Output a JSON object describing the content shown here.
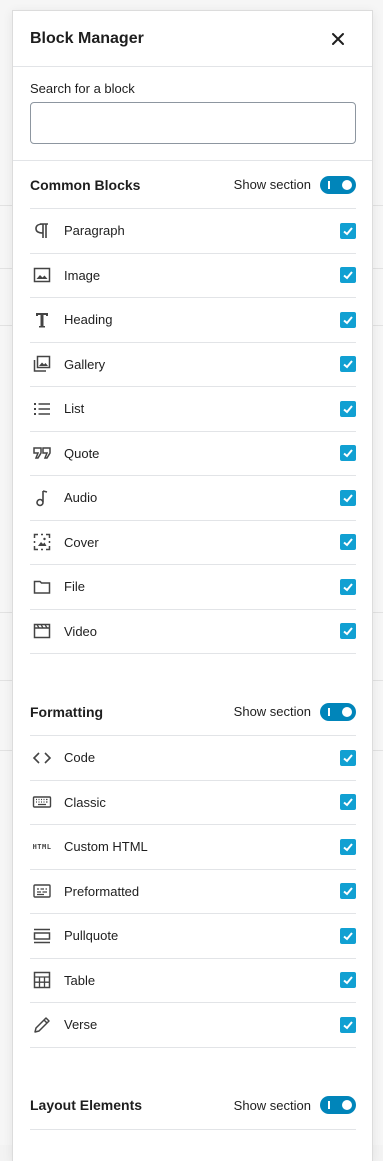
{
  "modal": {
    "title": "Block Manager",
    "close_icon": "close-icon"
  },
  "search": {
    "label": "Search for a block",
    "value": "",
    "placeholder": ""
  },
  "sections": [
    {
      "title": "Common Blocks",
      "toggle_label": "Show section",
      "toggle_on": true,
      "items": [
        {
          "label": "Paragraph",
          "icon": "paragraph-icon",
          "checked": true
        },
        {
          "label": "Image",
          "icon": "image-icon",
          "checked": true
        },
        {
          "label": "Heading",
          "icon": "heading-icon",
          "checked": true
        },
        {
          "label": "Gallery",
          "icon": "gallery-icon",
          "checked": true
        },
        {
          "label": "List",
          "icon": "list-icon",
          "checked": true
        },
        {
          "label": "Quote",
          "icon": "quote-icon",
          "checked": true
        },
        {
          "label": "Audio",
          "icon": "audio-icon",
          "checked": true
        },
        {
          "label": "Cover",
          "icon": "cover-icon",
          "checked": true
        },
        {
          "label": "File",
          "icon": "file-icon",
          "checked": true
        },
        {
          "label": "Video",
          "icon": "video-icon",
          "checked": true
        }
      ]
    },
    {
      "title": "Formatting",
      "toggle_label": "Show section",
      "toggle_on": true,
      "items": [
        {
          "label": "Code",
          "icon": "code-icon",
          "checked": true
        },
        {
          "label": "Classic",
          "icon": "keyboard-icon",
          "checked": true
        },
        {
          "label": "Custom HTML",
          "icon": "html-icon",
          "checked": true
        },
        {
          "label": "Preformatted",
          "icon": "preformatted-icon",
          "checked": true
        },
        {
          "label": "Pullquote",
          "icon": "pullquote-icon",
          "checked": true
        },
        {
          "label": "Table",
          "icon": "table-icon",
          "checked": true
        },
        {
          "label": "Verse",
          "icon": "pencil-icon",
          "checked": true
        }
      ]
    },
    {
      "title": "Layout Elements",
      "toggle_label": "Show section",
      "toggle_on": true,
      "items": []
    }
  ],
  "icons": {
    "html_text": "HTML"
  },
  "colors": {
    "accent": "#0085ba",
    "checkbox": "#11a0d2"
  }
}
